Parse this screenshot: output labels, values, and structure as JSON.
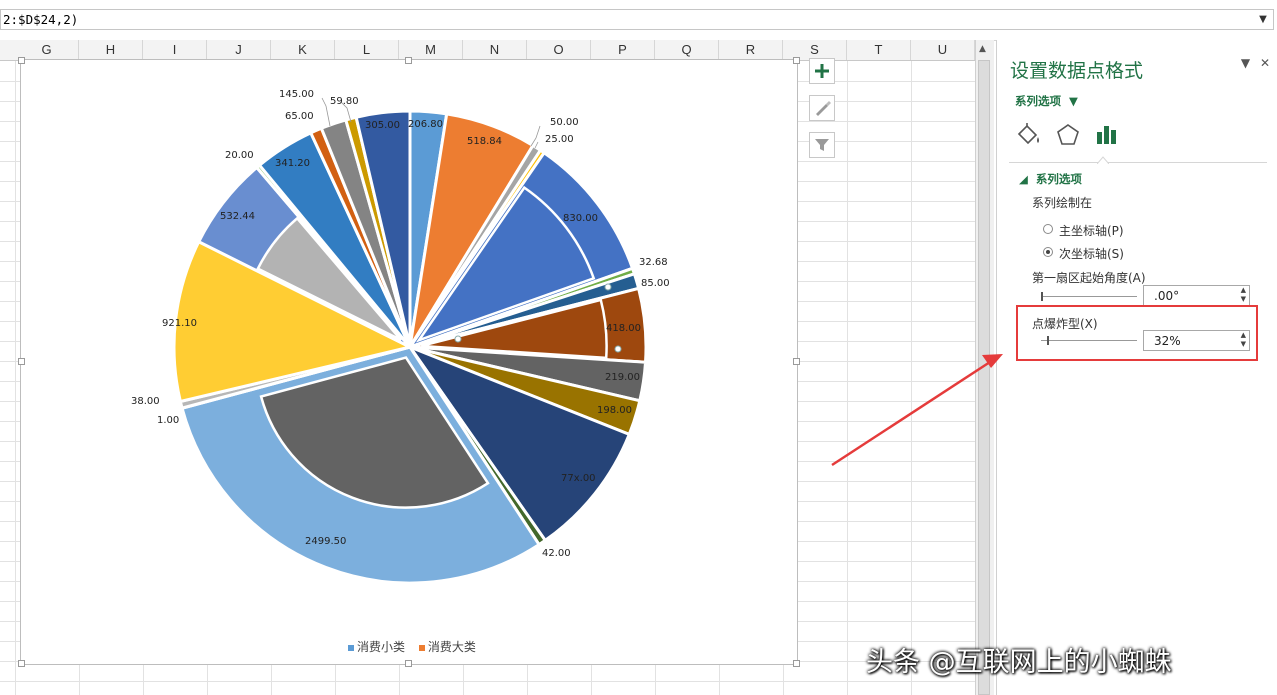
{
  "formula_bar": {
    "text": "2:$D$24,2)"
  },
  "columns": [
    "G",
    "H",
    "I",
    "J",
    "K",
    "L",
    "M",
    "N",
    "O",
    "P",
    "Q",
    "R",
    "S",
    "T",
    "U"
  ],
  "chart_data": {
    "type": "pie",
    "primary_series_label": "消费小类",
    "secondary_series_label": "消费大类",
    "inner_labels": {
      "s305": "305.00",
      "s206": "206.80",
      "s518": "518.84",
      "s830": "830.00",
      "s418": "418.00",
      "s219": "219.00",
      "s198": "198.00",
      "s77x": "77x.00",
      "s2499": "2499.50",
      "s921": "921.10",
      "s532": "532.44",
      "s341": "341.20"
    },
    "outer_labels": {
      "l50": "50.00",
      "l25": "25.00",
      "l3268": "32.68",
      "l85": "85.00",
      "l42": "42.00",
      "l38": "38.00",
      "l1": "1.00",
      "l20": "20.00",
      "l65": "65.00",
      "l145": "145.00",
      "l5980": "59.80"
    },
    "slices": [
      {
        "value": 206.8,
        "color": "#5b9bd5"
      },
      {
        "value": 518.84,
        "color": "#ed7d31"
      },
      {
        "value": 50.0,
        "color": "#a5a5a5"
      },
      {
        "value": 25.0,
        "color": "#ffc000"
      },
      {
        "value": 830.0,
        "color": "#4472c4"
      },
      {
        "value": 32.68,
        "color": "#70ad47"
      },
      {
        "value": 85.0,
        "color": "#255e91"
      },
      {
        "value": 418.0,
        "color": "#9e480e"
      },
      {
        "value": 219.0,
        "color": "#636363"
      },
      {
        "value": 198.0,
        "color": "#997300"
      },
      {
        "value": 770.0,
        "color": "#264478"
      },
      {
        "value": 42.0,
        "color": "#43682b"
      },
      {
        "value": 2499.5,
        "color": "#7cafdd"
      },
      {
        "value": 1.0,
        "color": "#f1975a"
      },
      {
        "value": 38.0,
        "color": "#b7b7b7"
      },
      {
        "value": 921.1,
        "color": "#ffcd33"
      },
      {
        "value": 532.44,
        "color": "#698ed0"
      },
      {
        "value": 20.0,
        "color": "#8cc168"
      },
      {
        "value": 341.2,
        "color": "#327dc2"
      },
      {
        "value": 65.0,
        "color": "#d26012"
      },
      {
        "value": 145.0,
        "color": "#848484"
      },
      {
        "value": 59.8,
        "color": "#cc9a00"
      },
      {
        "value": 305.0,
        "color": "#335aa1"
      }
    ],
    "outer_ring_colors": [
      "#5b9bd5",
      "#ed7d31",
      "#a5a5a5",
      "#ffc000",
      "#4472c4",
      "#70ad47"
    ],
    "legend": [
      {
        "label": "消费小类",
        "color": "#5b9bd5"
      },
      {
        "label": "消费大类",
        "color": "#ed7d31"
      }
    ],
    "explosion_percent": 32
  },
  "pane": {
    "title": "设置数据点格式",
    "series_dropdown": "系列选项",
    "section": "系列选项",
    "plot_on_label": "系列绘制在",
    "primary_axis": "主坐标轴(P)",
    "secondary_axis": "次坐标轴(S)",
    "first_angle_label": "第一扇区起始角度(A)",
    "first_angle_value": ".00°",
    "explosion_label": "点爆炸型(X)",
    "explosion_value": "32%",
    "icon_names": [
      "fill-line-icon",
      "effects-pentagon-icon",
      "series-options-bar-icon"
    ]
  },
  "watermark": "头条 @互联网上的小蜘蛛",
  "colors": {
    "accent": "#217346",
    "highlight_box": "#e53b3b"
  }
}
